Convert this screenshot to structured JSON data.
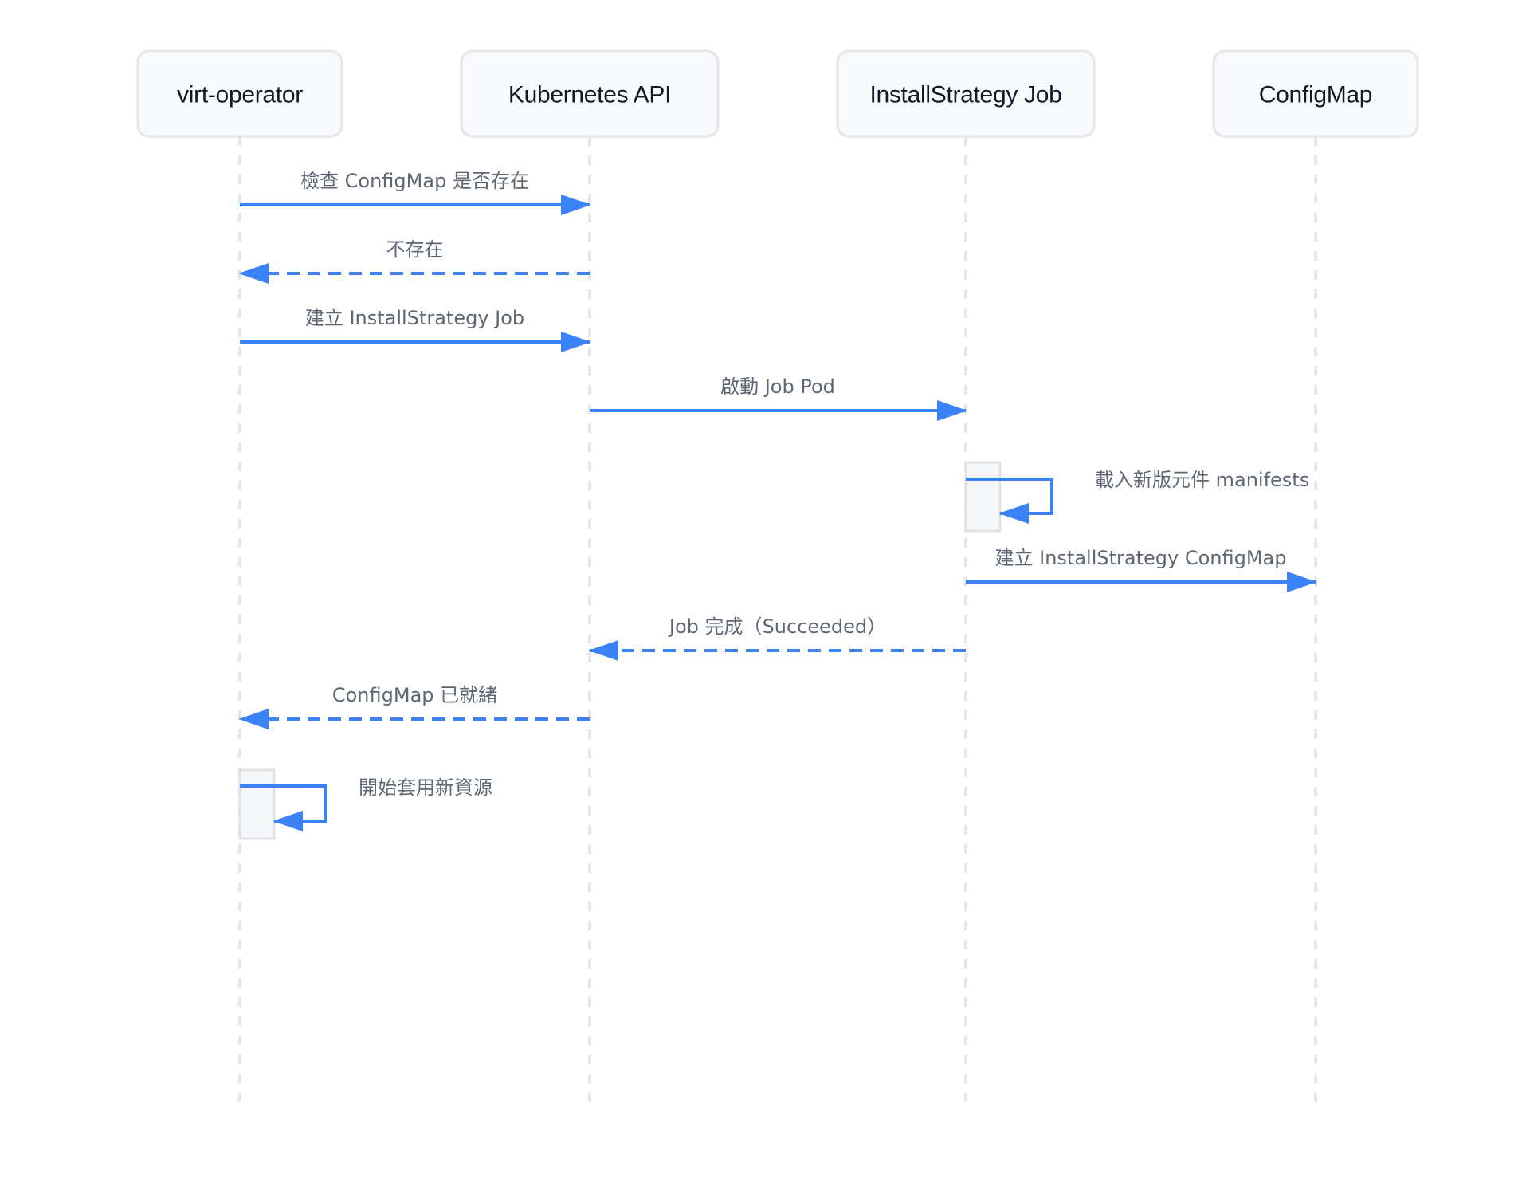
{
  "colors": {
    "arrow": "#3b82f6"
  },
  "participants": [
    {
      "id": "operator",
      "label": "virt-operator"
    },
    {
      "id": "api",
      "label": "Kubernetes API"
    },
    {
      "id": "job",
      "label": "InstallStrategy Job"
    },
    {
      "id": "cm",
      "label": "ConfigMap"
    }
  ],
  "messages": [
    {
      "from": "operator",
      "to": "api",
      "label": "檢查 ConfigMap 是否存在",
      "style": "solid"
    },
    {
      "from": "api",
      "to": "operator",
      "label": "不存在",
      "style": "dashed"
    },
    {
      "from": "operator",
      "to": "api",
      "label": "建立 InstallStrategy Job",
      "style": "solid"
    },
    {
      "from": "api",
      "to": "job",
      "label": "啟動 Job Pod",
      "style": "solid"
    },
    {
      "from": "job",
      "to": "job",
      "label": "載入新版元件 manifests",
      "style": "self"
    },
    {
      "from": "job",
      "to": "cm",
      "label": "建立 InstallStrategy ConfigMap",
      "style": "solid"
    },
    {
      "from": "job",
      "to": "api",
      "label": "Job 完成（Succeeded）",
      "style": "dashed"
    },
    {
      "from": "api",
      "to": "operator",
      "label": "ConfigMap 已就緒",
      "style": "dashed"
    },
    {
      "from": "operator",
      "to": "operator",
      "label": "開始套用新資源",
      "style": "self"
    }
  ]
}
